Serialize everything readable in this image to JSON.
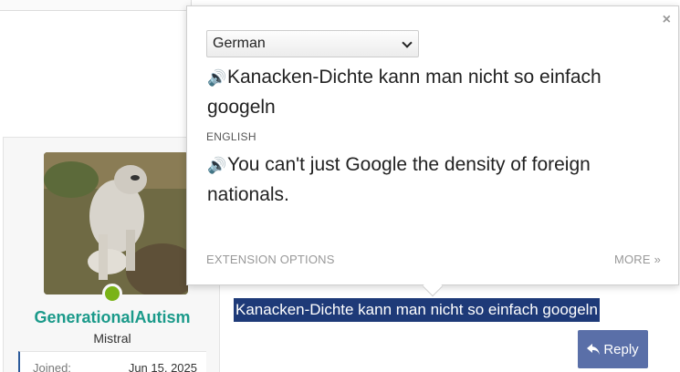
{
  "popup": {
    "close_label": "×",
    "language_selected": "German",
    "source_text": "Kanacken-Dichte kann man nicht so einfach googeln",
    "target_language_label": "ENGLISH",
    "translated_text": "You can't just Google the density of foreign nationals.",
    "extension_options_label": "EXTENSION OPTIONS",
    "more_label": "MORE »"
  },
  "user": {
    "username": "GenerationalAutism",
    "title": "Mistral",
    "joined_label": "Joined:",
    "joined_value": "Jun 15, 2025",
    "status_color": "#7ab317",
    "username_color": "#1b9a8a"
  },
  "post": {
    "selected_text": "Kanacken-Dichte kann man nicht so einfach googeln",
    "reply_label": "Reply",
    "reply_icon": "reply-arrow-icon"
  },
  "colors": {
    "selection_bg": "#1e3a78",
    "reply_button_bg": "#5a6fa8"
  }
}
